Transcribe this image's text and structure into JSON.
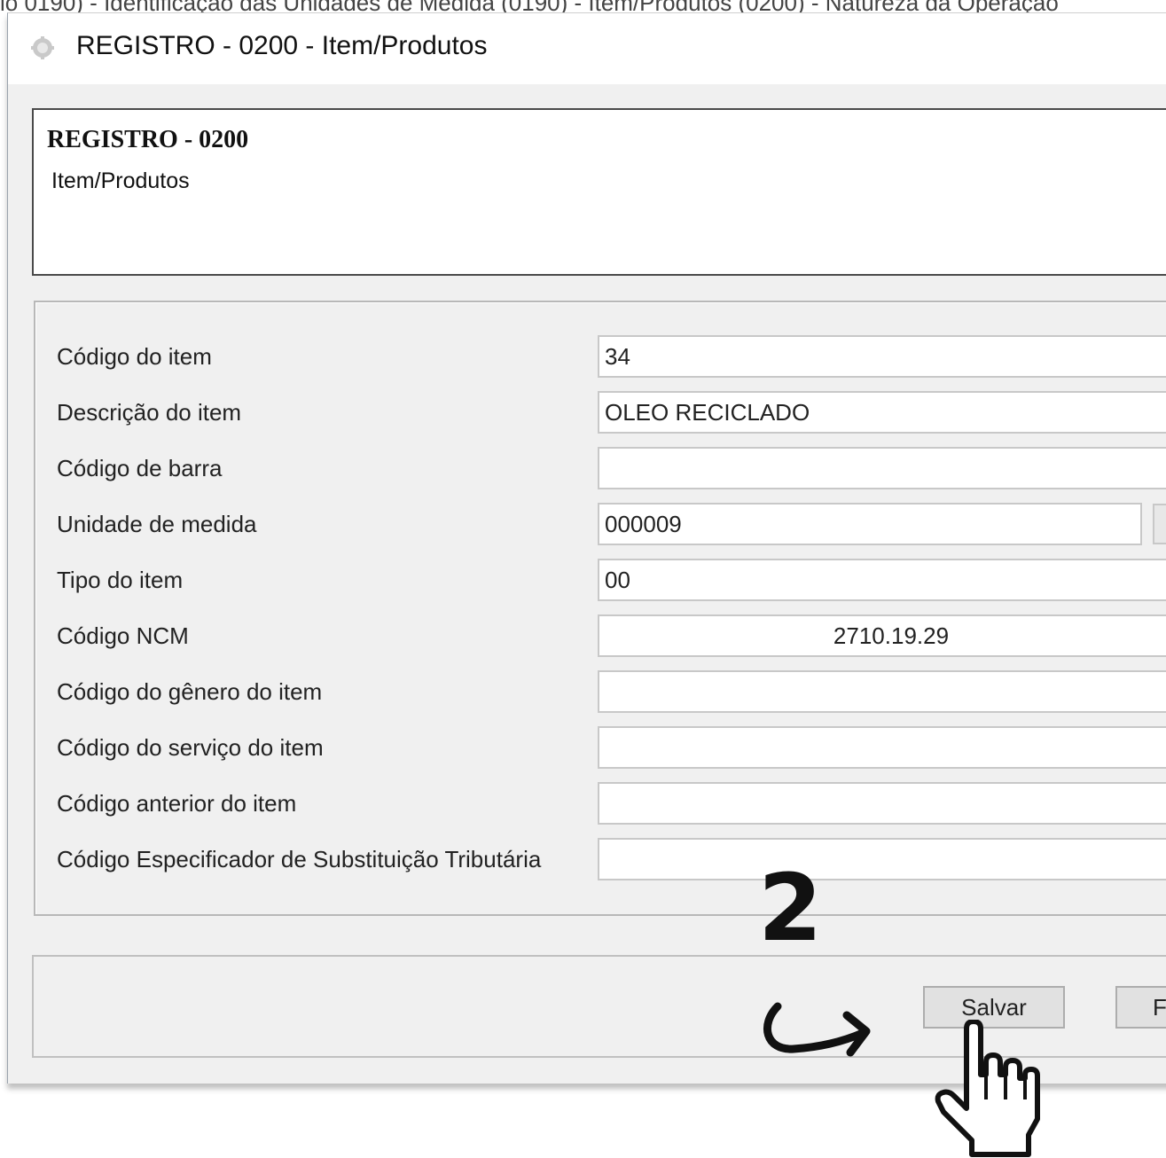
{
  "background_text": "io 0190) - Identificação das Unidades de Medida (0190) - Item/Produtos (0200) - Natureza da Operação",
  "window": {
    "title": "REGISTRO - 0200 - Item/Produtos"
  },
  "header": {
    "title": "REGISTRO - 0200",
    "subtitle": "Item/Produtos"
  },
  "fields": [
    {
      "label": "Código do item",
      "value": "34"
    },
    {
      "label": "Descrição do item",
      "value": "OLEO RECICLADO"
    },
    {
      "label": "Código de barra",
      "value": ""
    },
    {
      "label": "Unidade de medida",
      "value": "000009"
    },
    {
      "label": "Tipo do item",
      "value": "00"
    },
    {
      "label": "Código NCM",
      "value": "2710.19.29"
    },
    {
      "label": "Código do gênero do item",
      "value": ""
    },
    {
      "label": "Código do serviço do item",
      "value": ""
    },
    {
      "label": "Código anterior do item",
      "value": ""
    },
    {
      "label": "Código Especificador de Substituição Tributária",
      "value": ""
    }
  ],
  "buttons": {
    "save": "Salvar",
    "next_partial": "F"
  },
  "annotation": {
    "step_number": "2"
  },
  "icons": {
    "app": "app-icon",
    "arrow": "curved-arrow-icon",
    "cursor": "hand-pointer-icon"
  }
}
